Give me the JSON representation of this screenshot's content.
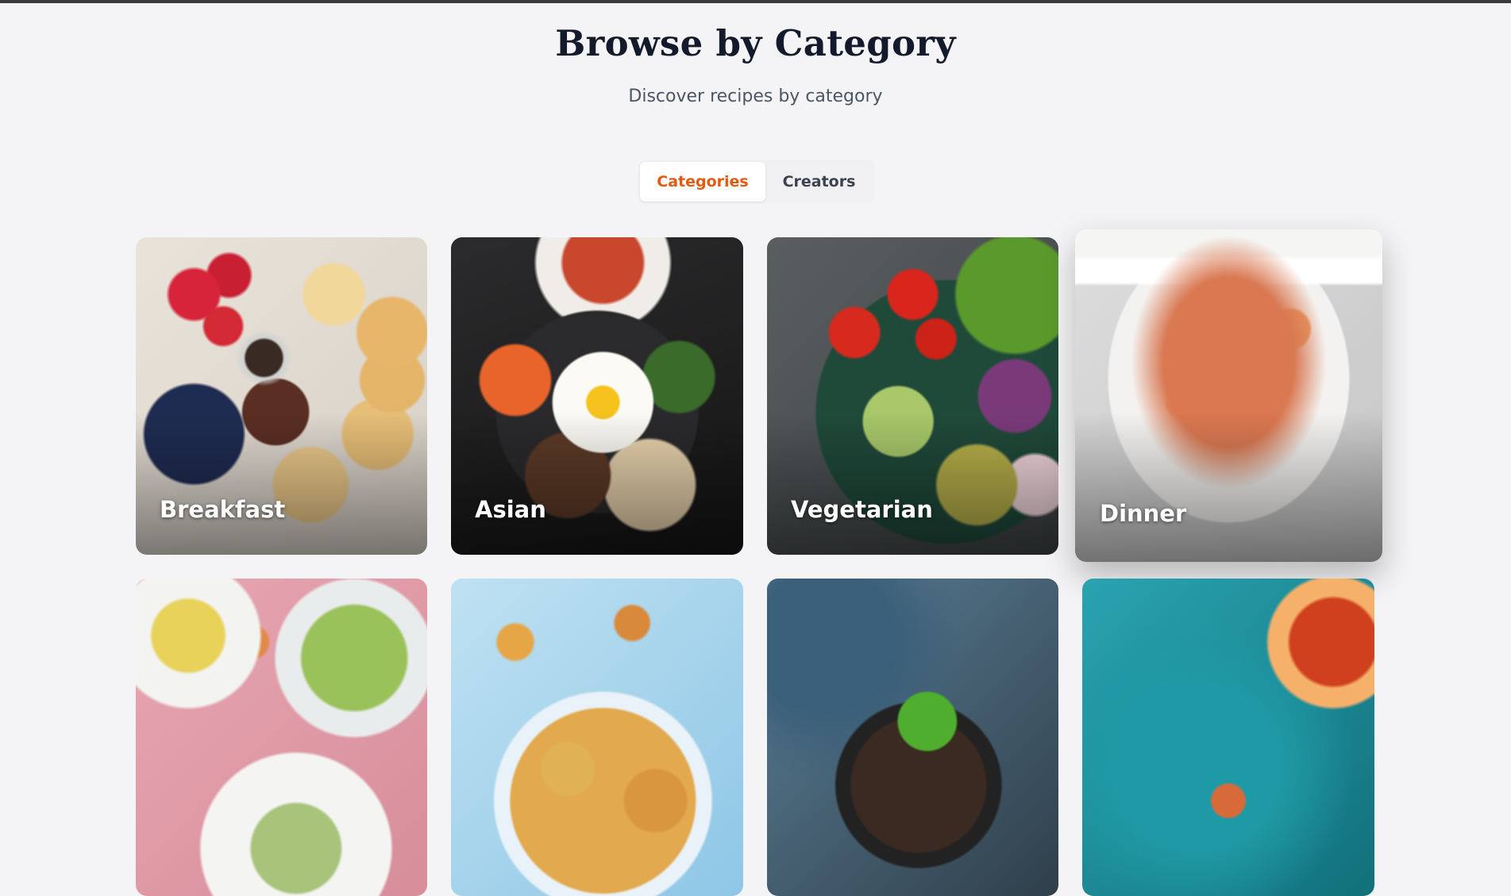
{
  "header": {
    "title": "Browse by Category",
    "subtitle": "Discover recipes by category"
  },
  "tabs": [
    {
      "label": "Categories",
      "active": true
    },
    {
      "label": "Creators",
      "active": false
    }
  ],
  "colors": {
    "accent": "#e35a12",
    "page_background": "#f4f4f6",
    "title": "#121a2b"
  },
  "categories": [
    {
      "label": "Breakfast"
    },
    {
      "label": "Asian"
    },
    {
      "label": "Vegetarian"
    },
    {
      "label": "Dinner",
      "state": "hovered"
    },
    {
      "label": ""
    },
    {
      "label": ""
    },
    {
      "label": ""
    },
    {
      "label": ""
    }
  ]
}
